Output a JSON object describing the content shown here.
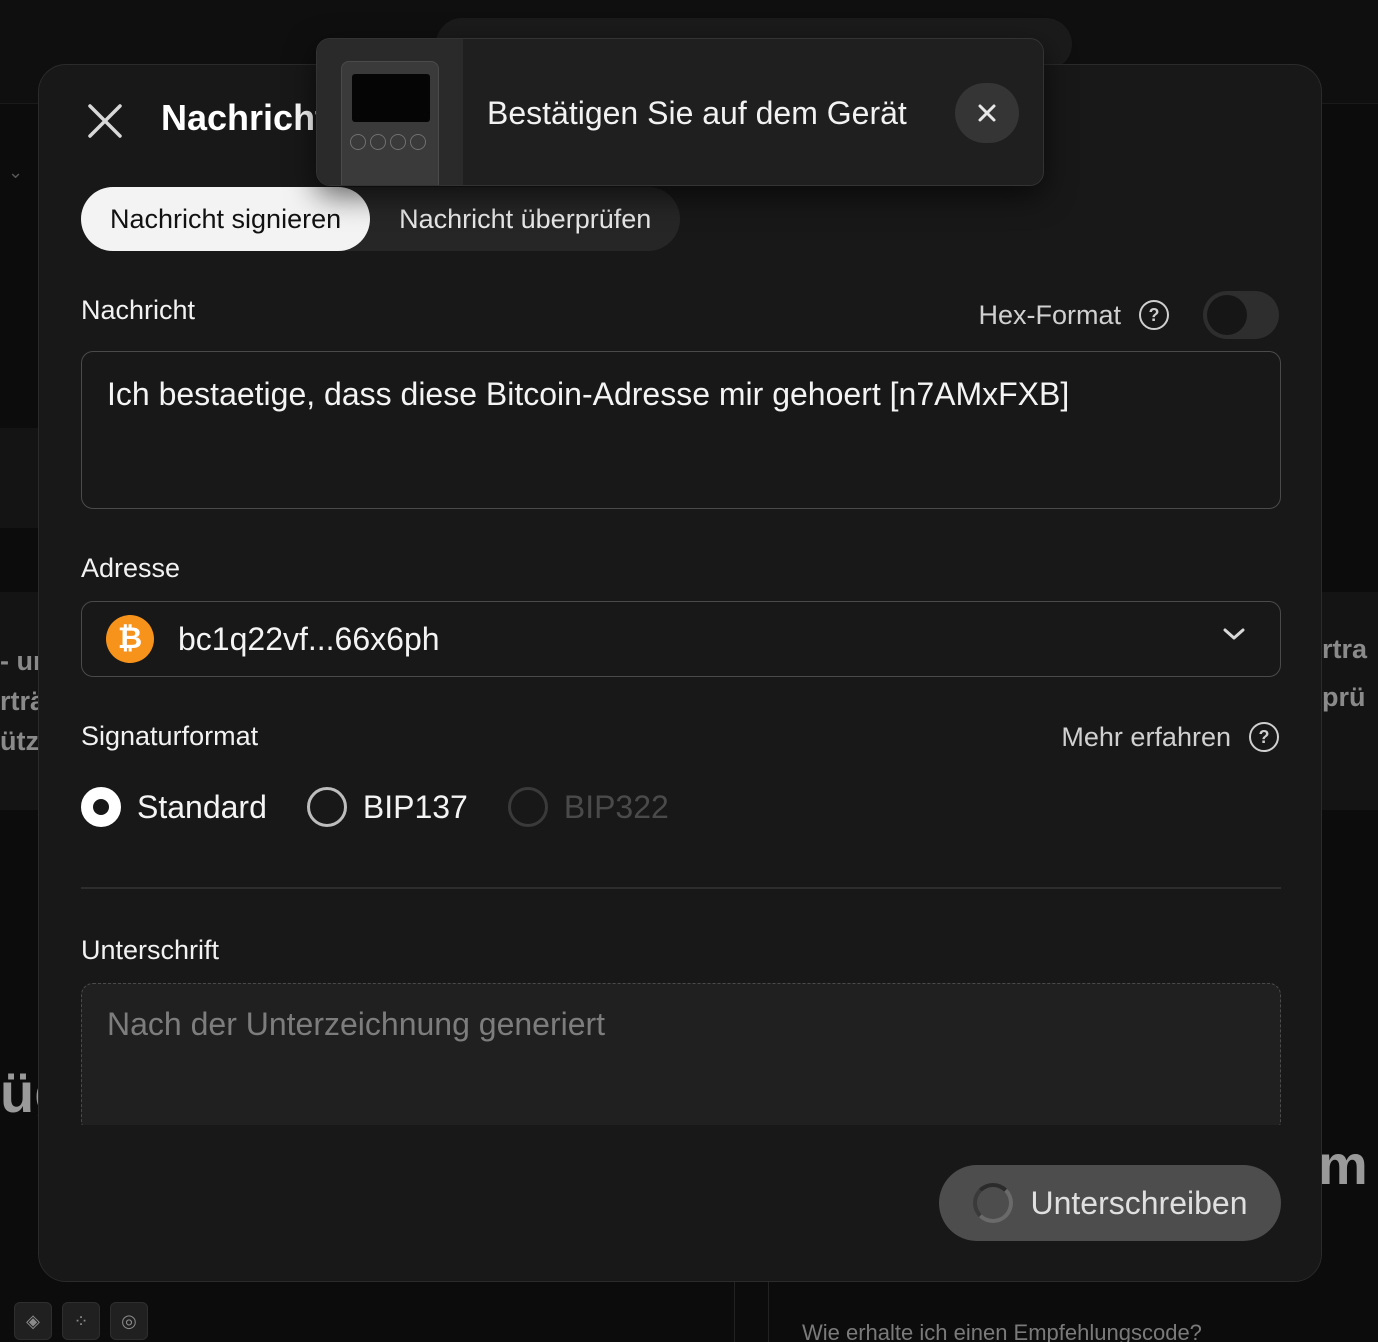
{
  "background": {
    "left_fragments": [
      "- ur",
      "rträ",
      "ützi"
    ],
    "right_fragments": [
      "rtra",
      "prü"
    ],
    "big_left": "üg",
    "big_right": "m",
    "faq_question": "Wie erhalte ich einen Empfehlungscode?"
  },
  "dialog": {
    "title": "Nachricht",
    "close_icon": "close-icon",
    "tabs": [
      {
        "label": "Nachricht signieren",
        "active": true
      },
      {
        "label": "Nachricht überprüfen",
        "active": false
      }
    ],
    "message": {
      "label": "Nachricht",
      "hex_label": "Hex-Format",
      "hex_enabled": false,
      "value": "Ich bestaetige, dass diese Bitcoin-Adresse mir gehoert [n7AMxFXB]"
    },
    "address": {
      "label": "Adresse",
      "coin_icon": "bitcoin-icon",
      "value": "bc1q22vf...66x6ph"
    },
    "signature_format": {
      "label": "Signaturformat",
      "learn_more": "Mehr erfahren",
      "options": [
        {
          "label": "Standard",
          "checked": true,
          "disabled": false
        },
        {
          "label": "BIP137",
          "checked": false,
          "disabled": false
        },
        {
          "label": "BIP322",
          "checked": false,
          "disabled": true
        }
      ]
    },
    "signature": {
      "label": "Unterschrift",
      "placeholder": "Nach der Unterzeichnung generiert"
    },
    "sign_button": "Unterschreiben"
  },
  "toast": {
    "text": "Bestätigen Sie auf dem Gerät",
    "device_icon": "hardware-wallet-icon"
  },
  "colors": {
    "bitcoin": "#f7931a",
    "dialog_bg": "#181818",
    "active_tab_bg": "#f3f3f3"
  }
}
